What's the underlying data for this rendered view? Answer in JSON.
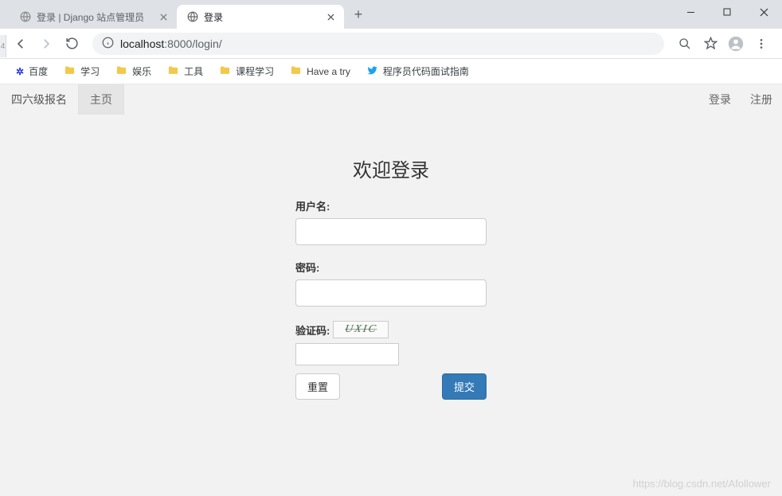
{
  "browser": {
    "tabs": [
      {
        "title": "登录 | Django 站点管理员",
        "active": false
      },
      {
        "title": "登录",
        "active": true
      }
    ],
    "url_host": "localhost",
    "url_port": ":8000",
    "url_path": "/login/",
    "bookmarks": [
      {
        "label": "百度",
        "icon": "baidu"
      },
      {
        "label": "学习",
        "icon": "folder"
      },
      {
        "label": "娱乐",
        "icon": "folder"
      },
      {
        "label": "工具",
        "icon": "folder"
      },
      {
        "label": "课程学习",
        "icon": "folder"
      },
      {
        "label": "Have a try",
        "icon": "folder"
      },
      {
        "label": "程序员代码面试指南",
        "icon": "twitter"
      }
    ]
  },
  "page": {
    "nav": {
      "brand": "四六级报名",
      "home": "主页",
      "login": "登录",
      "register": "注册"
    },
    "login_form": {
      "title": "欢迎登录",
      "username_label": "用户名:",
      "username_value": "",
      "password_label": "密码:",
      "password_value": "",
      "captcha_label": "验证码:",
      "captcha_text": "UXIC",
      "captcha_value": "",
      "reset_label": "重置",
      "submit_label": "提交"
    }
  },
  "watermark": "https://blog.csdn.net/Afollower",
  "edge_num": "4"
}
